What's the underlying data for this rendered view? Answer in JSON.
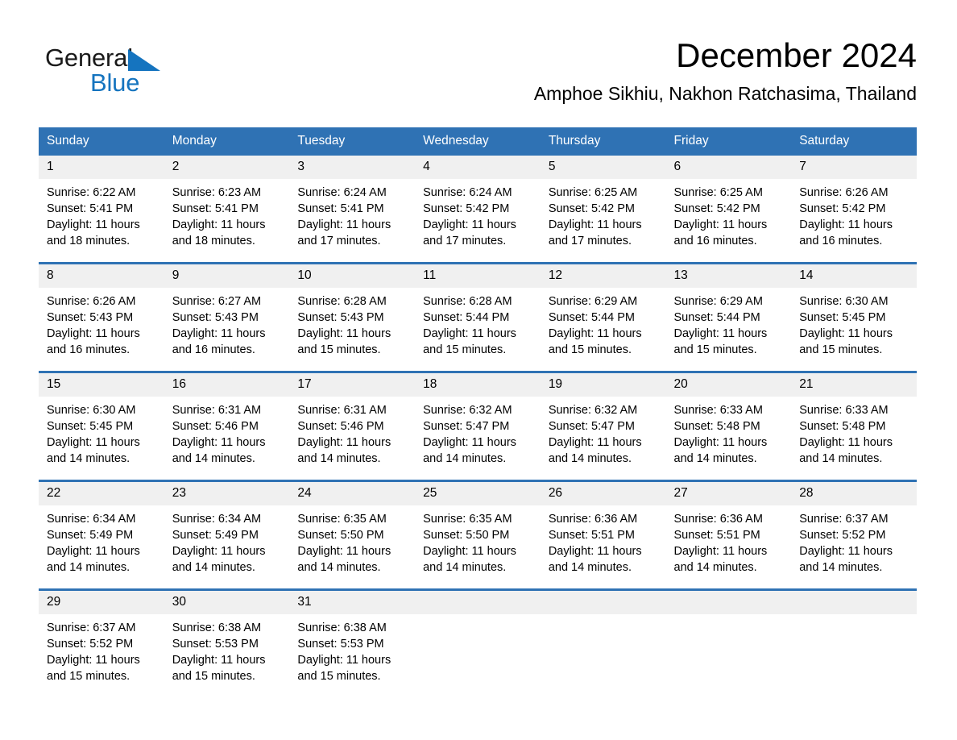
{
  "brand": {
    "name_part1": "General",
    "name_part2": "Blue",
    "triangle_color": "#1574bf"
  },
  "header": {
    "title": "December 2024",
    "subtitle": "Amphoe Sikhiu, Nakhon Ratchasima, Thailand"
  },
  "theme": {
    "header_blue": "#2f72b4",
    "daynum_gray": "#f0f0f0",
    "text_black": "#000000",
    "brand_blue": "#1574bf"
  },
  "weekday_headers": [
    "Sunday",
    "Monday",
    "Tuesday",
    "Wednesday",
    "Thursday",
    "Friday",
    "Saturday"
  ],
  "weeks": [
    [
      {
        "day": "1",
        "sunrise": "Sunrise: 6:22 AM",
        "sunset": "Sunset: 5:41 PM",
        "daylight_line1": "Daylight: 11 hours",
        "daylight_line2": "and 18 minutes."
      },
      {
        "day": "2",
        "sunrise": "Sunrise: 6:23 AM",
        "sunset": "Sunset: 5:41 PM",
        "daylight_line1": "Daylight: 11 hours",
        "daylight_line2": "and 18 minutes."
      },
      {
        "day": "3",
        "sunrise": "Sunrise: 6:24 AM",
        "sunset": "Sunset: 5:41 PM",
        "daylight_line1": "Daylight: 11 hours",
        "daylight_line2": "and 17 minutes."
      },
      {
        "day": "4",
        "sunrise": "Sunrise: 6:24 AM",
        "sunset": "Sunset: 5:42 PM",
        "daylight_line1": "Daylight: 11 hours",
        "daylight_line2": "and 17 minutes."
      },
      {
        "day": "5",
        "sunrise": "Sunrise: 6:25 AM",
        "sunset": "Sunset: 5:42 PM",
        "daylight_line1": "Daylight: 11 hours",
        "daylight_line2": "and 17 minutes."
      },
      {
        "day": "6",
        "sunrise": "Sunrise: 6:25 AM",
        "sunset": "Sunset: 5:42 PM",
        "daylight_line1": "Daylight: 11 hours",
        "daylight_line2": "and 16 minutes."
      },
      {
        "day": "7",
        "sunrise": "Sunrise: 6:26 AM",
        "sunset": "Sunset: 5:42 PM",
        "daylight_line1": "Daylight: 11 hours",
        "daylight_line2": "and 16 minutes."
      }
    ],
    [
      {
        "day": "8",
        "sunrise": "Sunrise: 6:26 AM",
        "sunset": "Sunset: 5:43 PM",
        "daylight_line1": "Daylight: 11 hours",
        "daylight_line2": "and 16 minutes."
      },
      {
        "day": "9",
        "sunrise": "Sunrise: 6:27 AM",
        "sunset": "Sunset: 5:43 PM",
        "daylight_line1": "Daylight: 11 hours",
        "daylight_line2": "and 16 minutes."
      },
      {
        "day": "10",
        "sunrise": "Sunrise: 6:28 AM",
        "sunset": "Sunset: 5:43 PM",
        "daylight_line1": "Daylight: 11 hours",
        "daylight_line2": "and 15 minutes."
      },
      {
        "day": "11",
        "sunrise": "Sunrise: 6:28 AM",
        "sunset": "Sunset: 5:44 PM",
        "daylight_line1": "Daylight: 11 hours",
        "daylight_line2": "and 15 minutes."
      },
      {
        "day": "12",
        "sunrise": "Sunrise: 6:29 AM",
        "sunset": "Sunset: 5:44 PM",
        "daylight_line1": "Daylight: 11 hours",
        "daylight_line2": "and 15 minutes."
      },
      {
        "day": "13",
        "sunrise": "Sunrise: 6:29 AM",
        "sunset": "Sunset: 5:44 PM",
        "daylight_line1": "Daylight: 11 hours",
        "daylight_line2": "and 15 minutes."
      },
      {
        "day": "14",
        "sunrise": "Sunrise: 6:30 AM",
        "sunset": "Sunset: 5:45 PM",
        "daylight_line1": "Daylight: 11 hours",
        "daylight_line2": "and 15 minutes."
      }
    ],
    [
      {
        "day": "15",
        "sunrise": "Sunrise: 6:30 AM",
        "sunset": "Sunset: 5:45 PM",
        "daylight_line1": "Daylight: 11 hours",
        "daylight_line2": "and 14 minutes."
      },
      {
        "day": "16",
        "sunrise": "Sunrise: 6:31 AM",
        "sunset": "Sunset: 5:46 PM",
        "daylight_line1": "Daylight: 11 hours",
        "daylight_line2": "and 14 minutes."
      },
      {
        "day": "17",
        "sunrise": "Sunrise: 6:31 AM",
        "sunset": "Sunset: 5:46 PM",
        "daylight_line1": "Daylight: 11 hours",
        "daylight_line2": "and 14 minutes."
      },
      {
        "day": "18",
        "sunrise": "Sunrise: 6:32 AM",
        "sunset": "Sunset: 5:47 PM",
        "daylight_line1": "Daylight: 11 hours",
        "daylight_line2": "and 14 minutes."
      },
      {
        "day": "19",
        "sunrise": "Sunrise: 6:32 AM",
        "sunset": "Sunset: 5:47 PM",
        "daylight_line1": "Daylight: 11 hours",
        "daylight_line2": "and 14 minutes."
      },
      {
        "day": "20",
        "sunrise": "Sunrise: 6:33 AM",
        "sunset": "Sunset: 5:48 PM",
        "daylight_line1": "Daylight: 11 hours",
        "daylight_line2": "and 14 minutes."
      },
      {
        "day": "21",
        "sunrise": "Sunrise: 6:33 AM",
        "sunset": "Sunset: 5:48 PM",
        "daylight_line1": "Daylight: 11 hours",
        "daylight_line2": "and 14 minutes."
      }
    ],
    [
      {
        "day": "22",
        "sunrise": "Sunrise: 6:34 AM",
        "sunset": "Sunset: 5:49 PM",
        "daylight_line1": "Daylight: 11 hours",
        "daylight_line2": "and 14 minutes."
      },
      {
        "day": "23",
        "sunrise": "Sunrise: 6:34 AM",
        "sunset": "Sunset: 5:49 PM",
        "daylight_line1": "Daylight: 11 hours",
        "daylight_line2": "and 14 minutes."
      },
      {
        "day": "24",
        "sunrise": "Sunrise: 6:35 AM",
        "sunset": "Sunset: 5:50 PM",
        "daylight_line1": "Daylight: 11 hours",
        "daylight_line2": "and 14 minutes."
      },
      {
        "day": "25",
        "sunrise": "Sunrise: 6:35 AM",
        "sunset": "Sunset: 5:50 PM",
        "daylight_line1": "Daylight: 11 hours",
        "daylight_line2": "and 14 minutes."
      },
      {
        "day": "26",
        "sunrise": "Sunrise: 6:36 AM",
        "sunset": "Sunset: 5:51 PM",
        "daylight_line1": "Daylight: 11 hours",
        "daylight_line2": "and 14 minutes."
      },
      {
        "day": "27",
        "sunrise": "Sunrise: 6:36 AM",
        "sunset": "Sunset: 5:51 PM",
        "daylight_line1": "Daylight: 11 hours",
        "daylight_line2": "and 14 minutes."
      },
      {
        "day": "28",
        "sunrise": "Sunrise: 6:37 AM",
        "sunset": "Sunset: 5:52 PM",
        "daylight_line1": "Daylight: 11 hours",
        "daylight_line2": "and 14 minutes."
      }
    ],
    [
      {
        "day": "29",
        "sunrise": "Sunrise: 6:37 AM",
        "sunset": "Sunset: 5:52 PM",
        "daylight_line1": "Daylight: 11 hours",
        "daylight_line2": "and 15 minutes."
      },
      {
        "day": "30",
        "sunrise": "Sunrise: 6:38 AM",
        "sunset": "Sunset: 5:53 PM",
        "daylight_line1": "Daylight: 11 hours",
        "daylight_line2": "and 15 minutes."
      },
      {
        "day": "31",
        "sunrise": "Sunrise: 6:38 AM",
        "sunset": "Sunset: 5:53 PM",
        "daylight_line1": "Daylight: 11 hours",
        "daylight_line2": "and 15 minutes."
      },
      {
        "day": "",
        "sunrise": "",
        "sunset": "",
        "daylight_line1": "",
        "daylight_line2": ""
      },
      {
        "day": "",
        "sunrise": "",
        "sunset": "",
        "daylight_line1": "",
        "daylight_line2": ""
      },
      {
        "day": "",
        "sunrise": "",
        "sunset": "",
        "daylight_line1": "",
        "daylight_line2": ""
      },
      {
        "day": "",
        "sunrise": "",
        "sunset": "",
        "daylight_line1": "",
        "daylight_line2": ""
      }
    ]
  ]
}
